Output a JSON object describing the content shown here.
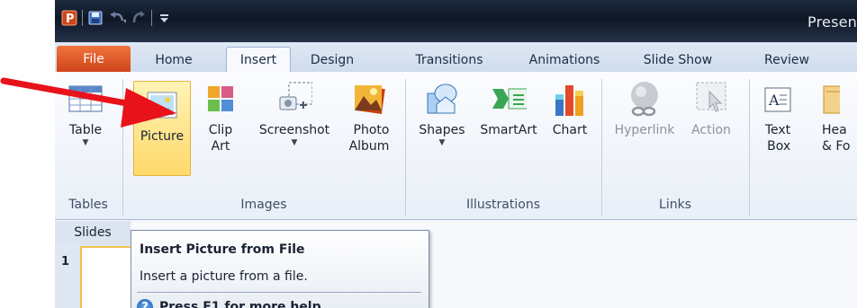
{
  "window": {
    "title": "Presen",
    "app_icon": "P"
  },
  "quick_access": [
    "save-icon",
    "undo-icon",
    "redo-icon",
    "customize-icon"
  ],
  "tabs": [
    {
      "label": "File"
    },
    {
      "label": "Home"
    },
    {
      "label": "Insert"
    },
    {
      "label": "Design"
    },
    {
      "label": "Transitions"
    },
    {
      "label": "Animations"
    },
    {
      "label": "Slide Show"
    },
    {
      "label": "Review"
    }
  ],
  "active_tab": "Insert",
  "ribbon": {
    "tables": {
      "group_label": "Tables",
      "table_label": "Table"
    },
    "images": {
      "group_label": "Images",
      "picture_label": "Picture",
      "clip_art_label": "Clip\nArt",
      "screenshot_label": "Screenshot",
      "photo_album_label": "Photo\nAlbum"
    },
    "illustrations": {
      "group_label": "Illustrations",
      "shapes_label": "Shapes",
      "smartart_label": "SmartArt",
      "chart_label": "Chart"
    },
    "links": {
      "group_label": "Links",
      "hyperlink_label": "Hyperlink",
      "action_label": "Action"
    },
    "text": {
      "text_box_label": "Text\nBox",
      "header_footer_label": "Hea\n& Fo"
    }
  },
  "slides_panel": {
    "tab_label": "Slides",
    "slide_number": "1"
  },
  "tooltip": {
    "title": "Insert Picture from File",
    "description": "Insert a picture from a file.",
    "help_text": "Press F1 for more help."
  },
  "colors": {
    "annotation_arrow": "#e8121b",
    "file_tab": "#e0561f",
    "picture_highlight": "#ffd96b"
  }
}
